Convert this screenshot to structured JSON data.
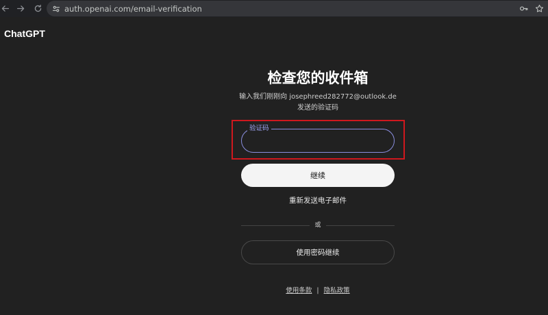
{
  "browser": {
    "url": "auth.openai.com/email-verification"
  },
  "header": {
    "brand": "ChatGPT"
  },
  "verify": {
    "title": "检查您的收件箱",
    "subtitle_line1": "输入我们刚刚向 josephreed282772@outlook.de",
    "subtitle_line2": "发送的验证码",
    "code_label": "验证码",
    "code_value": "",
    "continue_label": "继续",
    "resend_label": "重新发送电子邮件",
    "divider_text": "或",
    "password_label": "使用密码继续"
  },
  "footer": {
    "terms": "使用条款",
    "separator": "|",
    "privacy": "隐私政策"
  },
  "colors": {
    "background": "#212121",
    "field_border": "#8b8fe0",
    "highlight": "#d0181e",
    "button_bg": "#f4f4f4"
  },
  "icons": [
    "back-arrow-icon",
    "forward-arrow-icon",
    "reload-icon",
    "site-info-icon",
    "password-key-icon",
    "bookmark-star-icon"
  ]
}
